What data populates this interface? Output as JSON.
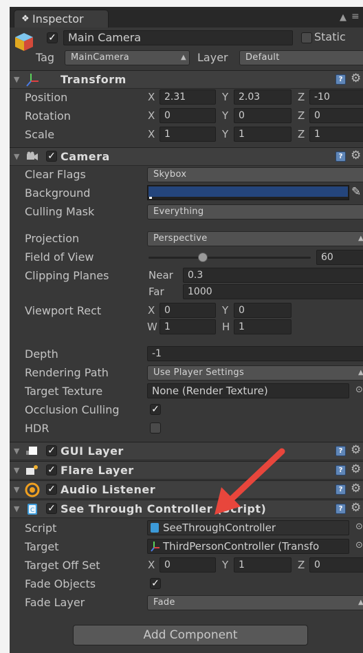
{
  "tab": {
    "label": "Inspector",
    "icon": "info-icon"
  },
  "header": {
    "object_name": "Main Camera",
    "static_label": "Static",
    "tag_label": "Tag",
    "tag_value": "MainCamera",
    "layer_label": "Layer",
    "layer_value": "Default"
  },
  "transform": {
    "title": "Transform",
    "rows": [
      {
        "label": "Position",
        "x": "2.31",
        "y": "2.03",
        "z": "-10"
      },
      {
        "label": "Rotation",
        "x": "0",
        "y": "0",
        "z": "0"
      },
      {
        "label": "Scale",
        "x": "1",
        "y": "1",
        "z": "1"
      }
    ]
  },
  "axes": {
    "x": "X",
    "y": "Y",
    "z": "Z",
    "w": "W",
    "h": "H"
  },
  "camera": {
    "title": "Camera",
    "clear_flags_label": "Clear Flags",
    "clear_flags_value": "Skybox",
    "background_label": "Background",
    "background_color": "#24457c",
    "culling_label": "Culling Mask",
    "culling_value": "Everything",
    "projection_label": "Projection",
    "projection_value": "Perspective",
    "fov_label": "Field of View",
    "fov_value": "60",
    "clipping_label": "Clipping Planes",
    "near_label": "Near",
    "near_value": "0.3",
    "far_label": "Far",
    "far_value": "1000",
    "viewport_label": "Viewport Rect",
    "viewport_x": "0",
    "viewport_y": "0",
    "viewport_w": "1",
    "viewport_h": "1",
    "depth_label": "Depth",
    "depth_value": "-1",
    "rendering_label": "Rendering Path",
    "rendering_value": "Use Player Settings",
    "target_texture_label": "Target Texture",
    "target_texture_value": "None (Render Texture)",
    "occlusion_label": "Occlusion Culling",
    "hdr_label": "HDR"
  },
  "components": {
    "gui_layer": "GUI Layer",
    "flare_layer": "Flare Layer",
    "audio_listener": "Audio Listener",
    "see_through": "See Through Controller (Script)"
  },
  "script": {
    "script_label": "Script",
    "script_value": "SeeThroughController",
    "target_label": "Target",
    "target_value": "ThirdPersonController (Transfo",
    "offset_label": "Target Off Set",
    "offset_x": "0",
    "offset_y": "1",
    "offset_z": "0",
    "fade_objects_label": "Fade Objects",
    "fade_layer_label": "Fade Layer",
    "fade_layer_value": "Fade"
  },
  "add_component": "Add Component",
  "colors": {
    "panel": "#383838",
    "help_icon": "#5f86b8",
    "annotation_arrow": "#e8463c"
  }
}
